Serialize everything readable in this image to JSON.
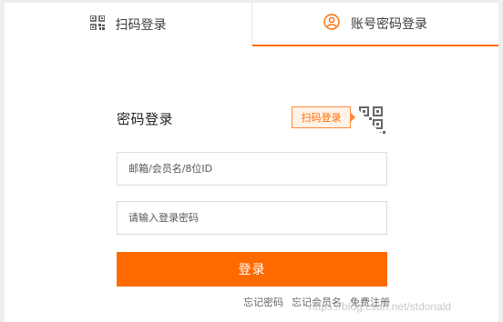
{
  "tabs": {
    "qr": {
      "label": "扫码登录",
      "icon": "qr-code-icon"
    },
    "password": {
      "label": "账号密码登录",
      "icon": "user-icon",
      "active": true
    }
  },
  "form": {
    "title": "密码登录",
    "qr_tip": "扫码登录",
    "username_placeholder": "邮箱/会员名/8位ID",
    "password_placeholder": "请输入登录密码",
    "submit_label": "登录"
  },
  "links": {
    "forgot_password": "忘记密码",
    "forgot_username": "忘记会员名",
    "register": "免费注册"
  },
  "watermark": "https://blog.csdn.net/stdonald",
  "colors": {
    "accent": "#ff6a00",
    "tip_bg": "#fff3e8"
  }
}
